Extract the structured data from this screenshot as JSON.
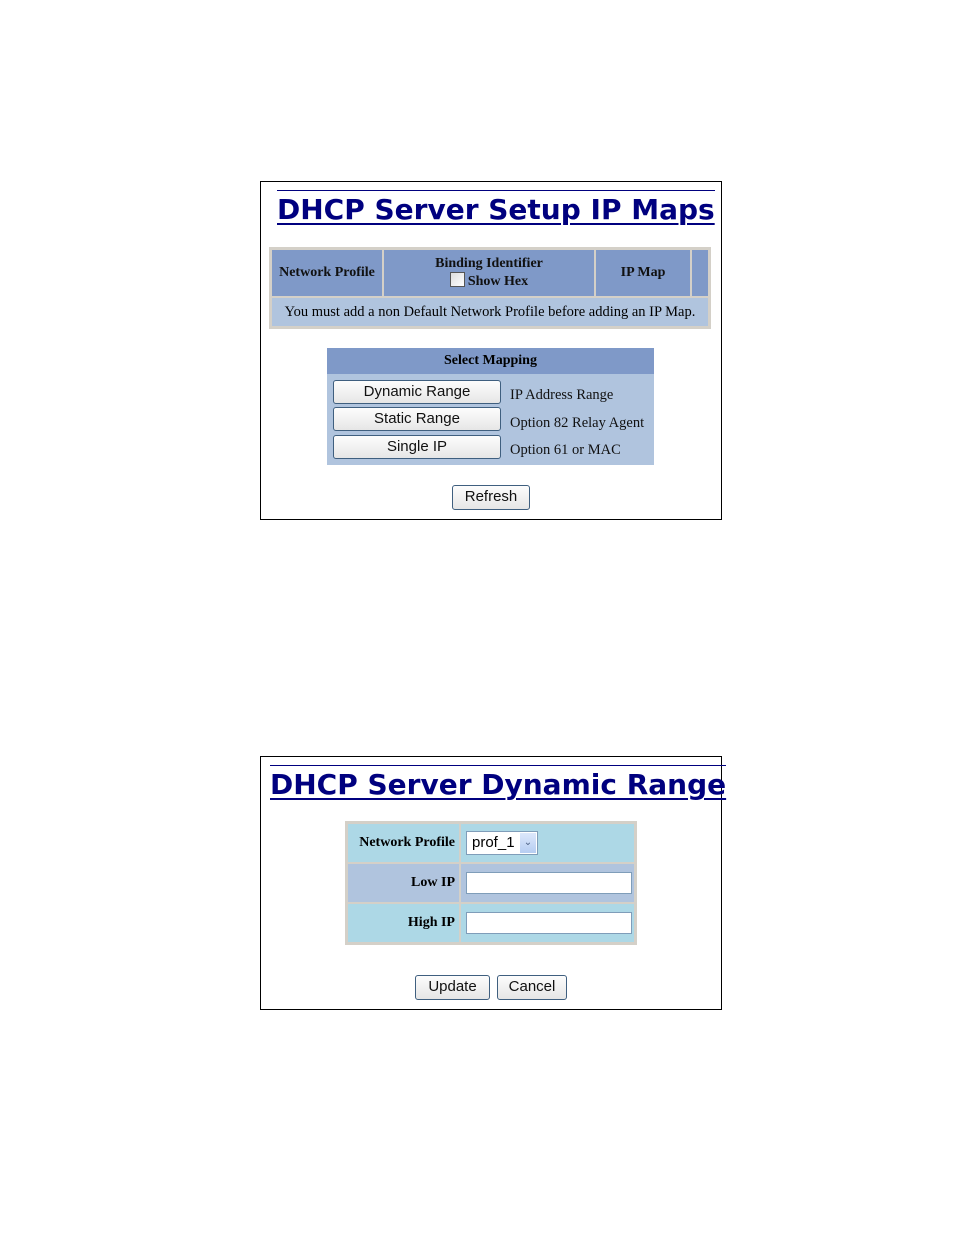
{
  "ip_maps": {
    "title": "DHCP Server Setup IP Maps",
    "table": {
      "headers": [
        "Network Profile",
        "Binding Identifier",
        "IP Map"
      ],
      "show_hex_label": "Show Hex",
      "show_hex_checked": false,
      "message": "You must add a non Default Network Profile before adding an IP Map."
    },
    "select_mapping": {
      "header": "Select Mapping",
      "options": [
        {
          "button": "Dynamic Range",
          "description": "IP Address Range"
        },
        {
          "button": "Static Range",
          "description": "Option 82 Relay Agent"
        },
        {
          "button": "Single IP",
          "description": "Option 61 or MAC"
        }
      ]
    },
    "refresh_label": "Refresh"
  },
  "dynamic_range": {
    "title": "DHCP Server Dynamic Range",
    "fields": {
      "network_profile_label": "Network Profile",
      "network_profile_value": "prof_1",
      "low_ip_label": "Low IP",
      "low_ip_value": "",
      "high_ip_label": "High IP",
      "high_ip_value": ""
    },
    "update_label": "Update",
    "cancel_label": "Cancel"
  }
}
